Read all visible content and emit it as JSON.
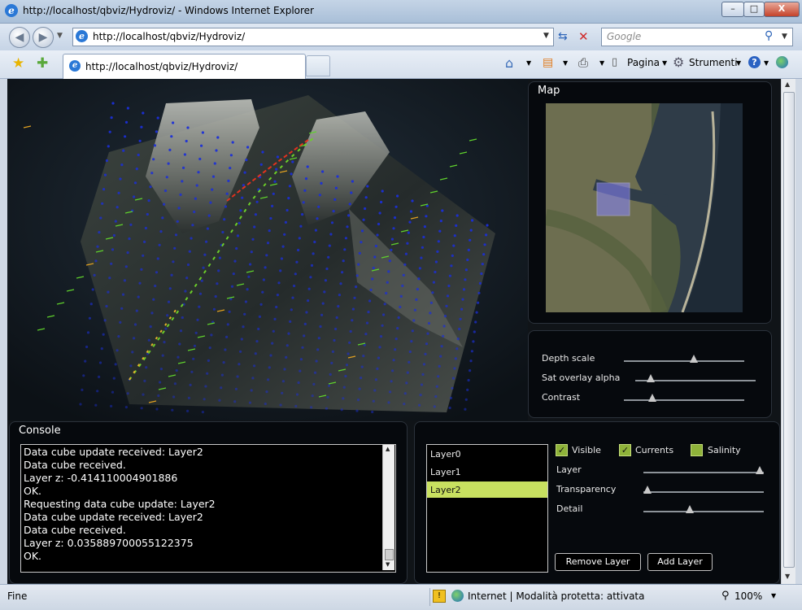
{
  "window": {
    "title": "http://localhost/qbviz/Hydroviz/ - Windows Internet Explorer",
    "buttons": {
      "minimize": "–",
      "maximize": "□",
      "close": "X"
    }
  },
  "nav": {
    "address": "http://localhost/qbviz/Hydroviz/",
    "search_placeholder": "Google"
  },
  "tab": {
    "title": "http://localhost/qbviz/Hydroviz/"
  },
  "commands": {
    "pagina": "Pagina",
    "strumenti": "Strumenti"
  },
  "map": {
    "title": "Map"
  },
  "settings": {
    "depth_scale": {
      "label": "Depth scale",
      "value": 0.59
    },
    "sat_overlay_alpha": {
      "label": "Sat overlay alpha",
      "value": 0.1
    },
    "contrast": {
      "label": "Contrast",
      "value": 0.22
    }
  },
  "console": {
    "title": "Console",
    "lines": [
      "Data cube update received: Layer2",
      "Data cube received.",
      "Layer z: -0.414110004901886",
      "OK.",
      "Requesting data cube update: Layer2",
      "Data cube update received: Layer2",
      "Data cube received.",
      "Layer z: 0.035889700055122375",
      "OK."
    ]
  },
  "layers": {
    "items": [
      "Layer0",
      "Layer1",
      "Layer2"
    ],
    "selected": "Layer2",
    "checkboxes": {
      "visible": "Visible",
      "currents": "Currents",
      "salinity": "Salinity"
    },
    "sliders": {
      "layer": {
        "label": "Layer",
        "value": 1.0
      },
      "transparency": {
        "label": "Transparency",
        "value": 0.0
      },
      "detail": {
        "label": "Detail",
        "value": 0.38
      }
    },
    "remove_button": "Remove Layer",
    "add_button": "Add Layer"
  },
  "status": {
    "left": "Fine",
    "zone": "Internet | Modalità protetta: attivata",
    "zoom": "100%"
  },
  "colors": {
    "accent_selected": "#c8e060",
    "checkbox": "#8fb33a",
    "vector_dots": "#1b2fd8"
  }
}
